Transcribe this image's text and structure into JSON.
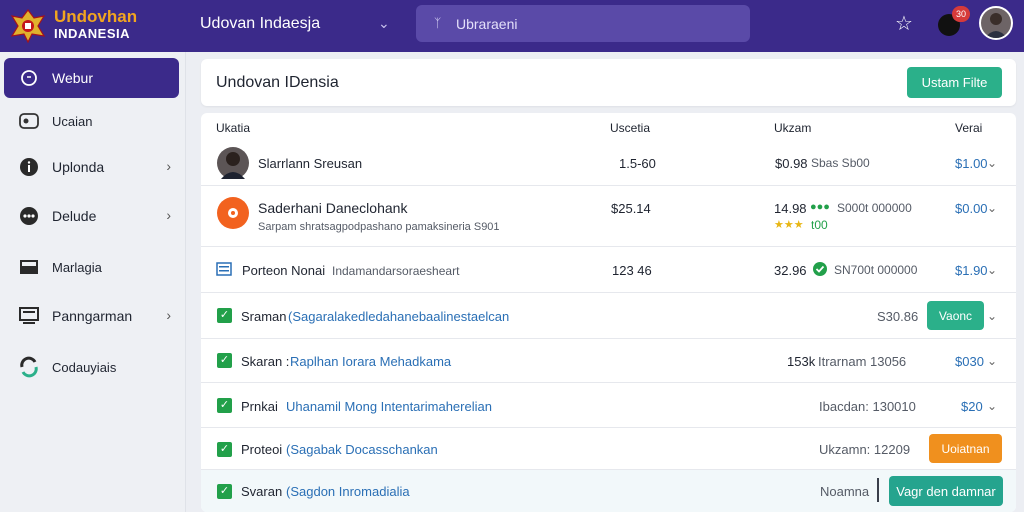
{
  "brand": {
    "line1": "Undovhan",
    "line2": "INDANESIA"
  },
  "workspace": {
    "title": "Udovan Indaesja"
  },
  "search": {
    "icon": "search-icon",
    "placeholder": "Ubraraeni"
  },
  "notifications": {
    "count": "30"
  },
  "colors": {
    "topbar": "#3b2a8a",
    "primary_button": "#2bb08a",
    "orange_button": "#f0901e",
    "link": "#2a6fb5",
    "check": "#22a04a"
  },
  "sidebar": {
    "items": [
      {
        "label": "Webur",
        "icon": "chat-icon",
        "active": true,
        "chevron": false
      },
      {
        "label": "Ucaian",
        "icon": "dashboard-icon",
        "active": false,
        "chevron": false
      },
      {
        "label": "Uplonda",
        "icon": "info-icon",
        "active": false,
        "chevron": true
      },
      {
        "label": "Delude",
        "icon": "dots-icon",
        "active": false,
        "chevron": true
      },
      {
        "label": "Marlagia",
        "icon": "layout-icon",
        "active": false,
        "chevron": false
      },
      {
        "label": "Panngarman",
        "icon": "monitor-icon",
        "active": false,
        "chevron": true
      },
      {
        "label": "Codauyiais",
        "icon": "swap-icon",
        "active": false,
        "chevron": false
      }
    ]
  },
  "page": {
    "title": "Undovan IDensia",
    "action_label": "Ustam Filte"
  },
  "table": {
    "headers": [
      "Ukatia",
      "Uscetia",
      "Ukzam",
      "Verai"
    ],
    "rows": [
      {
        "name": "Slarrlann Sreusan",
        "num": "1.5-60",
        "c3a": "$0.98",
        "c3b": "Sbas Sb00",
        "price": "$1.00"
      },
      {
        "name": "Saderhani Daneclohank",
        "sub": "Sarpam shratsagpodpashano pamaksineria S901",
        "num": "$25.14",
        "c3a": "14.98",
        "c3b": "S000t  000000",
        "c3c": "t00",
        "price": "$0.00"
      },
      {
        "name": "Porteon Nonai",
        "sub": "Indamandarsoraesheart",
        "num": "123 46",
        "c3a": "32.96",
        "c3b": "SN700t 000000",
        "price": "$1.90"
      },
      {
        "lead": "Sraman",
        "link": "(Sagaralakedledahanebaalinestaelcan",
        "c3b": "S30.86",
        "btn": "Vaonc"
      },
      {
        "lead": "Skaran :",
        "link": "Raplhan Iorara Mehadkama",
        "c3a": "153k",
        "c3b": "Itrarnam  13056",
        "price": "$030"
      },
      {
        "lead": "Prnkai",
        "link": "Uhanamil Mong Intentarimaherelian",
        "c3b": "Ibacdan:  130010",
        "price": "$20"
      },
      {
        "lead": "Proteoi",
        "link": "(Sagabak Docasschankan",
        "c3b": "Ukzamn:  12209",
        "btn": "Uoiatnan"
      },
      {
        "lead": "Svaran",
        "link": "(Sagdon Inromadialia",
        "c3b": "Noamna",
        "btn": "Vagr den damnar"
      }
    ]
  }
}
